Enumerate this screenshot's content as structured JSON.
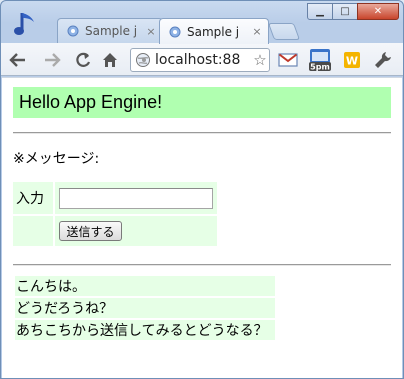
{
  "browser": {
    "tabs": [
      {
        "title": "Sample j",
        "close": "×",
        "active": false
      },
      {
        "title": "Sample j",
        "close": "×",
        "active": true
      }
    ],
    "window_controls": {
      "minimize": "▁",
      "maximize": "□",
      "close": "✕"
    },
    "address": "localhost:88",
    "icons": [
      "back-arrow-icon",
      "forward-arrow-icon",
      "reload-icon",
      "home-icon",
      "globe-icon",
      "star-icon",
      "gmail-icon",
      "calendar-icon",
      "extension-icon",
      "wrench-icon"
    ],
    "calendar_badge": "5pm",
    "extension_badge": "W",
    "accent": "#b0ffb0"
  },
  "page": {
    "header": "Hello App Engine!",
    "note": "※メッセージ:",
    "form": {
      "label": "入力",
      "input_value": "",
      "submit_label": "送信する"
    },
    "messages": [
      "こんちは。",
      "どうだろうね？",
      "あちこちから送信してみるとどうなる？"
    ],
    "colors": {
      "header_bg": "#b0ffb0",
      "cell_bg": "#e6ffe6"
    }
  }
}
